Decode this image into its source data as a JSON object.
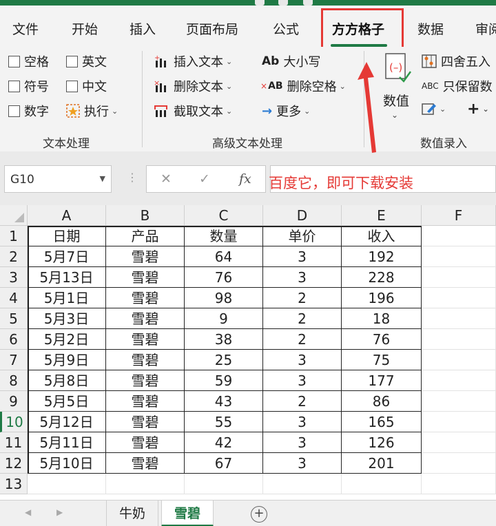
{
  "menu": {
    "items": [
      "文件",
      "开始",
      "插入",
      "页面布局",
      "公式",
      "方方格子",
      "数据",
      "审阅"
    ],
    "active": "方方格子"
  },
  "ribbon": {
    "text_group": {
      "checkboxes": [
        "空格",
        "英文",
        "符号",
        "中文",
        "数字"
      ],
      "execute": "执行",
      "label": "文本处理"
    },
    "advanced_group": {
      "insert_text": "插入文本",
      "delete_text": "删除文本",
      "cut_text": "截取文本",
      "case_icon": "Ab",
      "case": "大小写",
      "delete_space_icon": "AB",
      "delete_space": "删除空格",
      "more": "更多",
      "label": "高级文本处理"
    },
    "number_group": {
      "value": "数值",
      "round": "四舍五入",
      "keep_icon": "ABC",
      "keep": "只保留数",
      "plus": "+",
      "label": "数值录入"
    }
  },
  "formula_bar": {
    "name_box": "G10",
    "cancel": "✕",
    "confirm": "✓",
    "fx": "fx",
    "note": "百度它，即可下载安装"
  },
  "sheet": {
    "columns": [
      "A",
      "B",
      "C",
      "D",
      "E",
      "F"
    ],
    "row_numbers": [
      "1",
      "2",
      "3",
      "4",
      "5",
      "6",
      "7",
      "8",
      "9",
      "10",
      "11",
      "12",
      "13"
    ],
    "header": [
      "日期",
      "产品",
      "数量",
      "单价",
      "收入"
    ],
    "rows": [
      [
        "5月7日",
        "雪碧",
        "64",
        "3",
        "192"
      ],
      [
        "5月13日",
        "雪碧",
        "76",
        "3",
        "228"
      ],
      [
        "5月1日",
        "雪碧",
        "98",
        "2",
        "196"
      ],
      [
        "5月3日",
        "雪碧",
        "9",
        "2",
        "18"
      ],
      [
        "5月2日",
        "雪碧",
        "38",
        "2",
        "76"
      ],
      [
        "5月9日",
        "雪碧",
        "25",
        "3",
        "75"
      ],
      [
        "5月8日",
        "雪碧",
        "59",
        "3",
        "177"
      ],
      [
        "5月5日",
        "雪碧",
        "43",
        "2",
        "86"
      ],
      [
        "5月12日",
        "雪碧",
        "55",
        "3",
        "165"
      ],
      [
        "5月11日",
        "雪碧",
        "42",
        "3",
        "126"
      ],
      [
        "5月10日",
        "雪碧",
        "67",
        "3",
        "201"
      ]
    ],
    "selected_row": "10"
  },
  "tabs": {
    "sheets": [
      "牛奶",
      "雪碧"
    ],
    "active": "雪碧",
    "add": "+"
  },
  "colors": {
    "accent": "#1f7a45",
    "highlight": "#e53935"
  }
}
